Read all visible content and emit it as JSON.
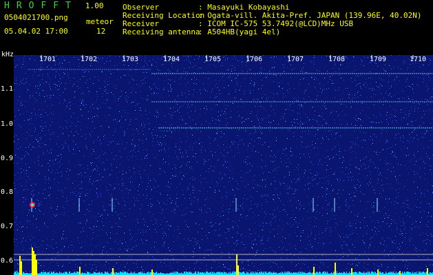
{
  "header": {
    "logo": "HROFFT",
    "version": "1.00",
    "filename": "0504021700.png",
    "timestamp": "05.04.02 17:00",
    "meteor_label": "meteor",
    "meteor_count": "12"
  },
  "info": [
    {
      "key": "Observer",
      "value": ": Masayuki Kobayashi"
    },
    {
      "key": "Receiving Location",
      "value": ": Ogata-vill. Akita-Pref. JAPAN (139.96E, 40.02N)"
    },
    {
      "key": "Receiver",
      "value": ": ICOM IC-575 53.7492(@LCD)MHz USB"
    },
    {
      "key": "Receiving antenna",
      "value": ": A504HB(yagi 4el)"
    }
  ],
  "axes": {
    "y_unit": "kHz",
    "y_ticks": [
      "1.1",
      "1.0",
      "0.9",
      "0.8",
      "0.7",
      "0.6"
    ],
    "x_ticks": [
      "1701",
      "1702",
      "1703",
      "1704",
      "1705",
      "1706",
      "1707",
      "1708",
      "1709",
      "1710"
    ]
  },
  "colors": {
    "background": "#000000",
    "spectrogram_bg": "#0a1570",
    "text_green": "#3cd43c",
    "text_yellow": "#ffff00",
    "text_white": "#ffffff",
    "signal_cyan": "#00e5ff",
    "meteor_bar": "#ffff00"
  }
}
